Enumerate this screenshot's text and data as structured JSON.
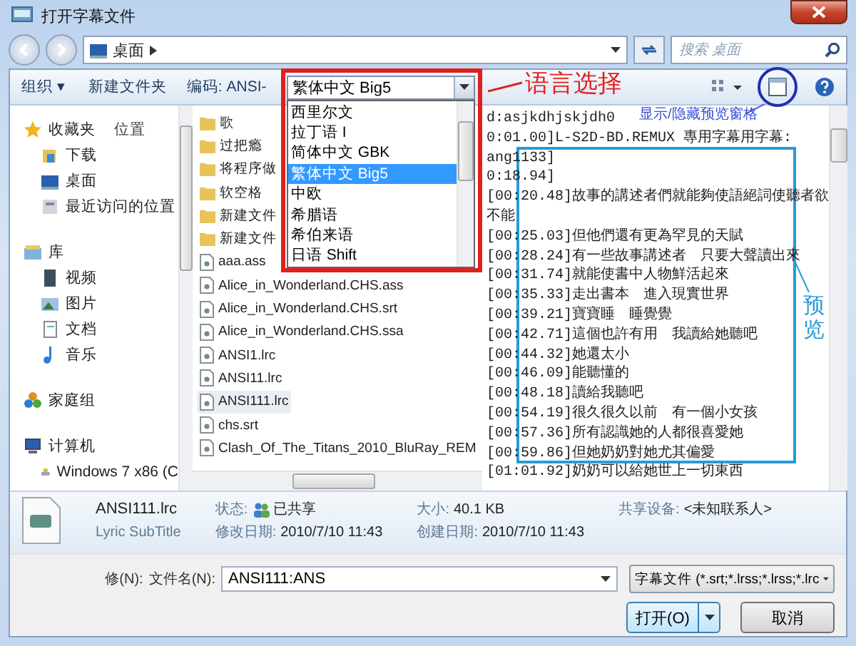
{
  "window": {
    "title": "打开字幕文件"
  },
  "address": {
    "path": "桌面",
    "search_placeholder": "搜索 桌面"
  },
  "toolbar": {
    "buttons": [
      "组织 ▾",
      "新建文件夹"
    ],
    "encoding_label": "编码: ANSI-",
    "encoding_value": "繁体中文 Big5"
  },
  "encoding_options": [
    {
      "label": "西里尔文",
      "selected": false
    },
    {
      "label": "拉丁语 I",
      "selected": false
    },
    {
      "label": "简体中文 GBK",
      "selected": false
    },
    {
      "label": "繁体中文 Big5",
      "selected": true
    },
    {
      "label": "中欧",
      "selected": false
    },
    {
      "label": "希腊语",
      "selected": false
    },
    {
      "label": "希伯来语",
      "selected": false
    },
    {
      "label": "日语 Shift",
      "selected": false
    }
  ],
  "nav": {
    "column_header": "位置",
    "groups": [
      {
        "label": "收藏夹",
        "kind": "favorites",
        "children": [
          {
            "label": "下载",
            "kind": "download"
          },
          {
            "label": "桌面",
            "kind": "desktop"
          },
          {
            "label": "最近访问的位置",
            "kind": "recent"
          }
        ]
      },
      {
        "label": "库",
        "kind": "library",
        "children": [
          {
            "label": "视频",
            "kind": "video"
          },
          {
            "label": "图片",
            "kind": "picture"
          },
          {
            "label": "文档",
            "kind": "document"
          },
          {
            "label": "音乐",
            "kind": "music"
          }
        ]
      },
      {
        "label": "家庭组",
        "kind": "homegroup"
      },
      {
        "label": "计算机",
        "kind": "computer",
        "children": [
          {
            "label": "Windows 7 x86 (C",
            "kind": "drive"
          }
        ]
      }
    ]
  },
  "files": [
    {
      "name": "歌",
      "kind": "folder",
      "selected": false
    },
    {
      "name": "过把瘾",
      "kind": "folder",
      "selected": false
    },
    {
      "name": "将程序做",
      "kind": "folder",
      "selected": false
    },
    {
      "name": "软空格",
      "kind": "folder",
      "selected": false
    },
    {
      "name": "新建文件",
      "kind": "folder",
      "selected": false
    },
    {
      "name": "新建文件",
      "kind": "folder",
      "selected": false
    },
    {
      "name": "aaa.ass",
      "kind": "file",
      "selected": false
    },
    {
      "name": "Alice_in_Wonderland.CHS.ass",
      "kind": "file",
      "selected": false
    },
    {
      "name": "Alice_in_Wonderland.CHS.srt",
      "kind": "file",
      "selected": false
    },
    {
      "name": "Alice_in_Wonderland.CHS.ssa",
      "kind": "file",
      "selected": false
    },
    {
      "name": "ANSI1.lrc",
      "kind": "file",
      "selected": false
    },
    {
      "name": "ANSI11.lrc",
      "kind": "file",
      "selected": false
    },
    {
      "name": "ANSI111.lrc",
      "kind": "file",
      "selected": true
    },
    {
      "name": "chs.srt",
      "kind": "file",
      "selected": false
    },
    {
      "name": "Clash_Of_The_Titans_2010_BluRay_REM",
      "kind": "file",
      "selected": false
    }
  ],
  "preview": {
    "lines": [
      "d:asjkdhjskjdh0",
      "0:01.00]L-S2D-BD.REMUX 專用字幕用字幕:",
      "ang1133]",
      "0:18.94]",
      "[00:20.48]故事的講述者們就能夠使語絕詞使聽者欲",
      "不能",
      "[00:25.03]但他們還有更為罕見的天賦",
      "[00:28.24]有一些故事講述者　只要大聲讀出來",
      "[00:31.74]就能使書中人物鮮活起來",
      "[00:35.33]走出書本　進入現實世界",
      "[00:39.21]寶寶睡　睡覺覺",
      "[00:42.71]這個也許有用　我讀給她聽吧",
      "[00:44.32]她還太小",
      "[00:46.09]能聽懂的",
      "[00:48.18]讀給我聽吧",
      "[00:54.19]很久很久以前　有一個小女孩",
      "[00:57.36]所有認識她的人都很喜愛她",
      "[00:59.86]但她奶奶對她尤其偏愛",
      "[01:01.92]奶奶可以給她世上一切東西"
    ]
  },
  "details": {
    "name": "ANSI111.lrc",
    "type": "Lyric SubTitle",
    "fields": [
      {
        "label": "状态:",
        "value": "已共享"
      },
      {
        "label": "修改日期:",
        "value": "2010/7/10 11:43"
      },
      {
        "label": "大小:",
        "value": "40.1 KB"
      },
      {
        "label": "创建日期:",
        "value": "2010/7/10 11:43"
      },
      {
        "label": "共享设备:",
        "value": "<未知联系人>"
      }
    ]
  },
  "footer": {
    "cut_label": "修(N):",
    "filename_label": "文件名(N):",
    "filename": "ANSI111:ANS",
    "filter": "字幕文件 (*.srt;*.lrss;*.lrss;*.lrc",
    "buttons": [
      "打开(O)",
      "取消"
    ]
  },
  "annotations": [
    {
      "kind": "language",
      "text": "语言选择"
    },
    {
      "kind": "preview_toggle",
      "text": "显示/隐藏预览窗格"
    },
    {
      "kind": "preview",
      "text": "预览"
    }
  ]
}
